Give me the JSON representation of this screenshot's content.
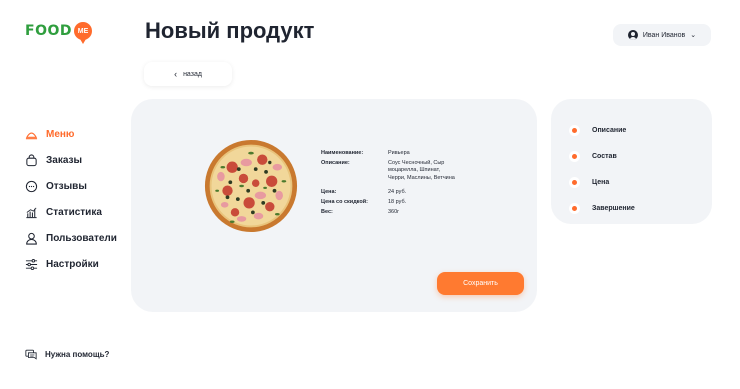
{
  "brand": {
    "logo_text": "FOOD",
    "logo_badge": "ME",
    "accent": "#ff6b2c",
    "green": "#2f9e3e"
  },
  "header": {
    "title": "Новый продукт",
    "user_name": "Иван Иванов"
  },
  "back_button": {
    "label": "назад"
  },
  "sidebar": {
    "items": [
      {
        "label": "Меню",
        "icon": "menu-icon",
        "active": true
      },
      {
        "label": "Заказы",
        "icon": "bag-icon",
        "active": false
      },
      {
        "label": "Отзывы",
        "icon": "chat-icon",
        "active": false
      },
      {
        "label": "Статистика",
        "icon": "stats-icon",
        "active": false
      },
      {
        "label": "Пользователи",
        "icon": "user-icon",
        "active": false
      },
      {
        "label": "Настройки",
        "icon": "settings-icon",
        "active": false
      }
    ],
    "help": "Нужна помощь?"
  },
  "product": {
    "name_label": "Наименование:",
    "name": "Ривьера",
    "description_label": "Описание:",
    "description": "Соус Чесночный, Сыр моцарелла, Шпинат, Черри, Маслины, Ветчина",
    "price_label": "Цена:",
    "price": "24 руб.",
    "discount_label": "Цена со скидкой:",
    "discount_price": "18 руб.",
    "weight_label": "Вес:",
    "weight": "360г"
  },
  "save_button": {
    "label": "Сохранить"
  },
  "steps": [
    {
      "label": "Описание"
    },
    {
      "label": "Состав"
    },
    {
      "label": "Цена"
    },
    {
      "label": "Завершение"
    }
  ]
}
